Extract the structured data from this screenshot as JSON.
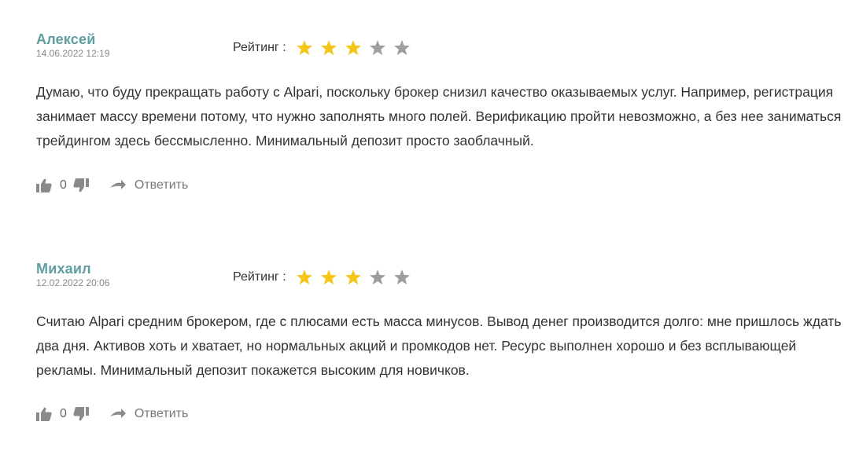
{
  "comments": [
    {
      "author": "Алексей",
      "date": "14.06.2022 12:19",
      "rating_label": "Рейтинг :",
      "rating": 3,
      "rating_max": 5,
      "text": "Думаю, что буду прекращать работу с Alpari, поскольку брокер снизил качество оказываемых услуг. Например, регистрация занимает массу времени потому, что нужно заполнять много полей. Верификацию пройти невозможно, а без нее заниматься трейдингом здесь бессмысленно. Минимальный депозит просто заоблачный.",
      "votes": "0",
      "reply_label": "Ответить"
    },
    {
      "author": "Михаил",
      "date": "12.02.2022 20:06",
      "rating_label": "Рейтинг :",
      "rating": 3,
      "rating_max": 5,
      "text": "Считаю Alpari средним брокером, где с плюсами есть масса минусов. Вывод денег производится долго: мне пришлось ждать два дня. Активов хоть и хватает, но нормальных акций и промкодов нет. Ресурс выполнен хорошо и без всплывающей рекламы. Минимальный депозит покажется высоким для новичков.",
      "votes": "0",
      "reply_label": "Ответить"
    }
  ],
  "colors": {
    "author": "#5f9ea0",
    "star_filled": "#f5c518",
    "star_empty": "#9e9e9e",
    "icon": "#8a8a8a"
  },
  "icons": {
    "like": "thumbs-up-icon",
    "dislike": "thumbs-down-icon",
    "reply": "reply-arrow-icon",
    "star": "star-icon"
  }
}
